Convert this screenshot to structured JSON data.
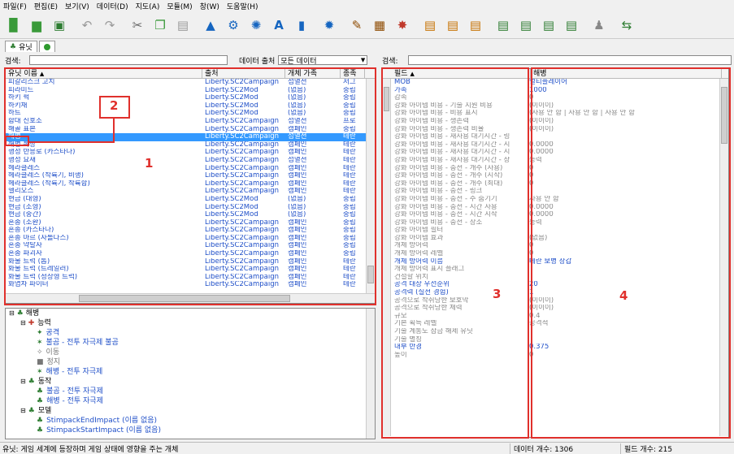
{
  "menu": [
    "파일(F)",
    "편집(E)",
    "보기(V)",
    "데이터(D)",
    "지도(A)",
    "모듈(M)",
    "창(W)",
    "도움말(H)"
  ],
  "tabs": {
    "units": "유닛"
  },
  "search": {
    "label_left": "검색:",
    "label_right": "검색:",
    "data_source_label": "데이터 출처",
    "data_source_value": "모든 데이터"
  },
  "unit_list": {
    "columns": [
      "유닛 이름",
      "출처",
      "개체 가족",
      "종족"
    ],
    "rows": [
      [
        "피갈리스크 고치",
        "Liberty.SC2Campaign",
        "섬멸전",
        "저그"
      ],
      [
        "피라미드",
        "Liberty.SC2Mod",
        "(없음)",
        "중립"
      ],
      [
        "하키 퍽",
        "Liberty.SC2Mod",
        "(없음)",
        "중립"
      ],
      [
        "하키채",
        "Liberty.SC2Mod",
        "(없음)",
        "중립"
      ],
      [
        "하트",
        "Liberty.SC2Mod",
        "(없음)",
        "중립"
      ],
      [
        "함대 신호소",
        "Liberty.SC2Campaign",
        "섬멸전",
        "프로"
      ],
      [
        "해골 표본",
        "Liberty.SC2Campaign",
        "캠페인",
        "중립"
      ],
      [
        "해병",
        "Liberty.SC2Campaign",
        "섬멸전",
        "테란"
      ],
      [
        "해병 복장",
        "Liberty.SC2Campaign",
        "캠페인",
        "테란"
      ],
      [
        "행성 반응로 (카스타나)",
        "Liberty.SC2Campaign",
        "캠페인",
        "테란"
      ],
      [
        "행성 요새",
        "Liberty.SC2Campaign",
        "섬멸전",
        "테란"
      ],
      [
        "헤라클레스",
        "Liberty.SC2Campaign",
        "캠페인",
        "테란"
      ],
      [
        "헤라클레스 (착륙기, 비행)",
        "Liberty.SC2Campaign",
        "캠페인",
        "테란"
      ],
      [
        "헤라클레스 (착륙기, 착륙함)",
        "Liberty.SC2Campaign",
        "캠페인",
        "테란"
      ],
      [
        "헬리오스",
        "Liberty.SC2Campaign",
        "캠페인",
        "테란"
      ],
      [
        "현금 (대형)",
        "Liberty.SC2Mod",
        "(없음)",
        "중립"
      ],
      [
        "현금 (소형)",
        "Liberty.SC2Mod",
        "(없음)",
        "중립"
      ],
      [
        "현금 (중간)",
        "Liberty.SC2Mod",
        "(없음)",
        "중립"
      ],
      [
        "혼종 (소환)",
        "Liberty.SC2Campaign",
        "캠페인",
        "중립"
      ],
      [
        "혼종 (카스타나)",
        "Liberty.SC2Campaign",
        "캠페인",
        "중립"
      ],
      [
        "혼종 마르 (자롤다스)",
        "Liberty.SC2Campaign",
        "캠페인",
        "중립"
      ],
      [
        "혼종 약탈자",
        "Liberty.SC2Campaign",
        "캠페인",
        "중립"
      ],
      [
        "혼종 파괴자",
        "Liberty.SC2Campaign",
        "캠페인",
        "중립"
      ],
      [
        "화물 트럭 (톱)",
        "Liberty.SC2Campaign",
        "캠페인",
        "테란"
      ],
      [
        "화물 트럭 (트레일러)",
        "Liberty.SC2Campaign",
        "캠페인",
        "테란"
      ],
      [
        "화물 트럭 (정상형 트럭)",
        "Liberty.SC2Campaign",
        "캠페인",
        "테란"
      ],
      [
        "화염차 파이터",
        "Liberty.SC2Campaign",
        "캠페인",
        "테란"
      ]
    ],
    "selected_index": 7
  },
  "tree": {
    "root": "해병",
    "items": [
      {
        "level": 1,
        "text": "능력",
        "type": "group",
        "icon": "ability-icon"
      },
      {
        "level": 2,
        "text": "공격",
        "type": "leaf",
        "icon": "attack-icon"
      },
      {
        "level": 2,
        "text": "불곰 - 전투 자극제 불곰",
        "type": "leaf",
        "icon": "stim-icon"
      },
      {
        "level": 2,
        "text": "이동",
        "type": "gray",
        "icon": "move-icon"
      },
      {
        "level": 2,
        "text": "정지",
        "type": "gray",
        "icon": "stop-icon"
      },
      {
        "level": 2,
        "text": "해병 - 전투 자극제",
        "type": "leaf",
        "icon": "stim-icon"
      },
      {
        "level": 1,
        "text": "동작",
        "type": "group",
        "icon": "behavior-icon"
      },
      {
        "level": 2,
        "text": "불곰 - 전투 자극제",
        "type": "leaf",
        "icon": "behavior-icon"
      },
      {
        "level": 2,
        "text": "해병 - 전투 자극제",
        "type": "leaf",
        "icon": "behavior-icon"
      },
      {
        "level": 1,
        "text": "모델",
        "type": "group",
        "icon": "model-icon"
      },
      {
        "level": 2,
        "text": "StimpackEndImpact (이름 없음)",
        "type": "leaf",
        "icon": "model-icon"
      },
      {
        "level": 2,
        "text": "StimpackStartImpact (이름 없음)",
        "type": "leaf",
        "icon": "model-icon"
      }
    ]
  },
  "fields": {
    "columns": [
      "필드",
      "해병"
    ],
    "rows": [
      {
        "f": "MOB",
        "v": "멀티플레이어",
        "hi": true
      },
      {
        "f": "가속",
        "v": "1000",
        "hi": true
      },
      {
        "f": "감속",
        "v": "0",
        "hi": false
      },
      {
        "f": "강화 아이템 비용 - 기술 지원 비용",
        "v": "(이이이)",
        "hi": false
      },
      {
        "f": "강화 아이템 비용 - 비용 표시",
        "v": "(사용 안 함 | 사용 안 함 | 사용 안 함",
        "hi": false
      },
      {
        "f": "강화 아이템 비용 - 생존력",
        "v": "(이이이)",
        "hi": false
      },
      {
        "f": "강화 아이템 비용 - 생존력 비율",
        "v": "(이이이)",
        "hi": false
      },
      {
        "f": "강화 아이템 비용 - 재사용 대기시간 - 링",
        "v": "",
        "hi": false
      },
      {
        "f": "강화 아이템 비용 - 재사용 대기시간 - 시",
        "v": "0.0000",
        "hi": false
      },
      {
        "f": "강화 아이템 비용 - 재사용 대기시간 - 시",
        "v": "0.0000",
        "hi": false
      },
      {
        "f": "강화 아이템 비용 - 재사용 대기시간 - 장",
        "v": "능력",
        "hi": false
      },
      {
        "f": "강화 아이템 비용 - 충전 - 개수 (사용)",
        "v": "0",
        "hi": false
      },
      {
        "f": "강화 아이템 비용 - 충전 - 개수 (시작)",
        "v": "0",
        "hi": false
      },
      {
        "f": "강화 아이템 비용 - 충전 - 개수 (최대)",
        "v": "0",
        "hi": false
      },
      {
        "f": "강화 아이템 비용 - 충전 - 링크",
        "v": "",
        "hi": false
      },
      {
        "f": "강화 아이템 비용 - 충전 - 수 숨기기",
        "v": "사용 안 함",
        "hi": false
      },
      {
        "f": "강화 아이템 비용 - 충전 - 시간 사용",
        "v": "0.0000",
        "hi": false
      },
      {
        "f": "강화 아이템 비용 - 충전 - 시간 시작",
        "v": "0.0000",
        "hi": false
      },
      {
        "f": "강화 아이템 비용 - 충전 - 장소",
        "v": "능력",
        "hi": false
      },
      {
        "f": "강화 아이템 필터",
        "v": "",
        "hi": false
      },
      {
        "f": "강화 아이템 효과",
        "v": "(없음)",
        "hi": false
      },
      {
        "f": "개체 방어력",
        "v": "0",
        "hi": false
      },
      {
        "f": "개체 방어력 레벨",
        "v": "0",
        "hi": false
      },
      {
        "f": "개체 방어력 이름",
        "v": "테란 보병 장갑",
        "hi": true
      },
      {
        "f": "개체 방어력 표시 플래그",
        "v": "",
        "hi": false
      },
      {
        "f": "건설할 위치",
        "v": "",
        "hi": false
      },
      {
        "f": "공격 대상 우선순위",
        "v": "20",
        "hi": true
      },
      {
        "f": "공격력 (실전 경험)",
        "v": "1",
        "hi": true
      },
      {
        "f": "공격으로 착취당한 보호막",
        "v": "(이이이)",
        "hi": false
      },
      {
        "f": "공격으로 착취당한 체력",
        "v": "(이이이)",
        "hi": false
      },
      {
        "f": "규모",
        "v": "0.4",
        "hi": false
      },
      {
        "f": "기본 획득 레벨",
        "v": "공격적",
        "hi": false
      },
      {
        "f": "기술 계통도 잠금 해제 유닛",
        "v": "",
        "hi": false
      },
      {
        "f": "기술 별칭",
        "v": "",
        "hi": false
      },
      {
        "f": "내부 반경",
        "v": "0.375",
        "hi": true
      },
      {
        "f": "높이",
        "v": "0",
        "hi": false
      }
    ]
  },
  "status": {
    "hint": "유닛: 게임 세계에 등장하며 게임 상태에 영향을 주는 개체",
    "data_count": "데이터 개수: 1306",
    "field_count": "필드 개수: 215"
  },
  "annotations": [
    "1",
    "2",
    "3",
    "4"
  ],
  "colors": {
    "annotation": "#e0302c",
    "link_blue": "#1f4fc8",
    "selection": "#3399ff"
  }
}
